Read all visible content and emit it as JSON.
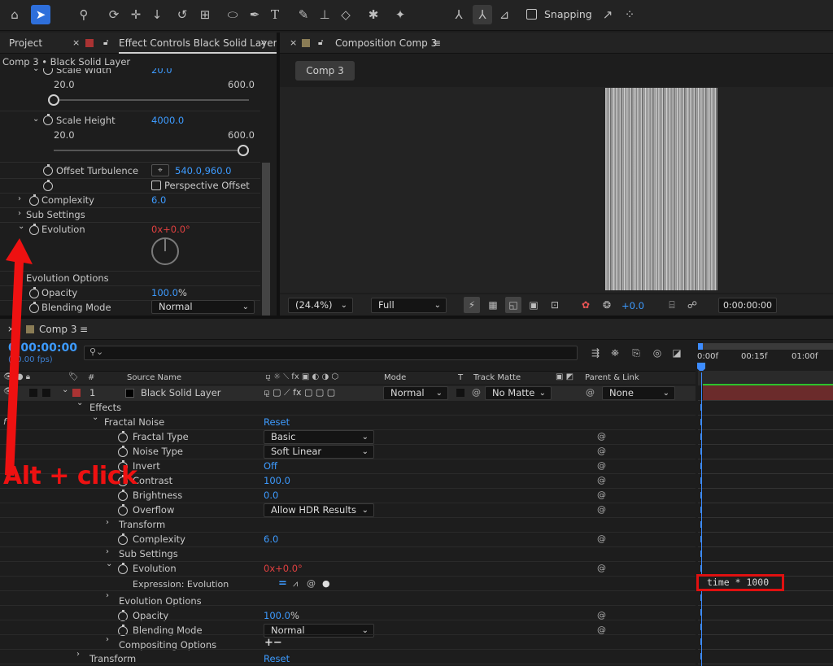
{
  "toolbar": {
    "snapping_label": "Snapping"
  },
  "left_panel": {
    "tab_project": "Project",
    "tab_effect_controls": "Effect Controls Black Solid Layer",
    "breadcrumb": "Comp 3 • Black Solid Layer",
    "scale_width_label": "Scale Width",
    "scale_width_value": "20.0",
    "slider1_min": "20.0",
    "slider1_max": "600.0",
    "scale_height_label": "Scale Height",
    "scale_height_value": "4000.0",
    "slider2_min": "20.0",
    "slider2_max": "600.0",
    "offset_label": "Offset Turbulence",
    "offset_value": "540.0,960.0",
    "perspective_label": "Perspective Offset",
    "complexity_label": "Complexity",
    "complexity_value": "6.0",
    "sub_settings_label": "Sub Settings",
    "evolution_label": "Evolution",
    "evolution_rev": "0x",
    "evolution_deg": "+0.0°",
    "evolution_options_label": "Evolution Options",
    "opacity_label": "Opacity",
    "opacity_value": "100.0",
    "opacity_unit": "%",
    "blending_label": "Blending Mode",
    "blending_value": "Normal"
  },
  "comp_panel": {
    "tab_label": "Composition Comp 3",
    "comp_button": "Comp 3",
    "zoom": "(24.4%)",
    "resolution": "Full",
    "exposure": "+0.0",
    "timecode": "0:00:00:00"
  },
  "timeline": {
    "tab_label": "Comp 3",
    "current_time": "0:00:00:00",
    "fps": "(30.00 fps)",
    "ruler": [
      "0:00f",
      "00:15f",
      "01:00f"
    ],
    "columns": {
      "source_name": "Source Name",
      "mode": "Mode",
      "t": "T",
      "track_matte": "Track Matte",
      "parent_link": "Parent & Link"
    },
    "layer": {
      "num": "1",
      "name": "Black Solid Layer",
      "mode": "Normal",
      "matte": "No Matte",
      "parent": "None"
    },
    "effects_label": "Effects",
    "fractal_noise_label": "Fractal Noise",
    "reset_label": "Reset",
    "props": [
      {
        "name": "Fractal Type",
        "value": "Basic"
      },
      {
        "name": "Noise Type",
        "value": "Soft Linear"
      },
      {
        "name": "Invert",
        "value": "Off"
      },
      {
        "name": "Contrast",
        "value": "100.0"
      },
      {
        "name": "Brightness",
        "value": "0.0"
      },
      {
        "name": "Overflow",
        "value": "Allow HDR Results"
      }
    ],
    "transform_label": "Transform",
    "complexity_label": "Complexity",
    "complexity_value": "6.0",
    "sub_settings_label": "Sub Settings",
    "evolution_label": "Evolution",
    "evolution_rev": "0x",
    "evolution_deg": "+0.0°",
    "expression_label": "Expression: Evolution",
    "expression_code": "time * 1000",
    "evolution_options_label": "Evolution Options",
    "opacity_label": "Opacity",
    "opacity_value": "100.0",
    "opacity_unit": "%",
    "blending_label": "Blending Mode",
    "blending_value": "Normal",
    "compositing_label": "Compositing Options",
    "transform2_label": "Transform",
    "reset2_label": "Reset"
  },
  "annotation": {
    "text": "Alt + click",
    "color": "#ee1111"
  }
}
